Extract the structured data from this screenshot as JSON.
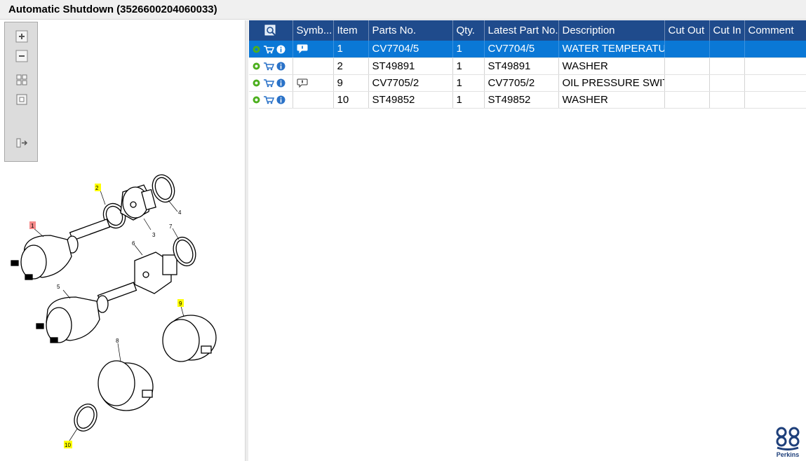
{
  "window": {
    "title": "Automatic Shutdown (3526600204060033)"
  },
  "toolbar": {
    "buttons": [
      {
        "name": "zoom-in-button",
        "icon": "zoom-in-icon"
      },
      {
        "name": "zoom-out-button",
        "icon": "zoom-out-icon"
      },
      {
        "name": "fit-all-button",
        "icon": "fit-all-icon"
      },
      {
        "name": "fit-window-button",
        "icon": "fit-window-icon"
      },
      {
        "name": "toggle-panel-button",
        "icon": "panel-toggle-icon"
      }
    ]
  },
  "diagram": {
    "callouts": [
      {
        "label": "1",
        "highlight": "#f58a8a"
      },
      {
        "label": "2",
        "highlight": "#ffff00"
      },
      {
        "label": "3"
      },
      {
        "label": "4"
      },
      {
        "label": "5"
      },
      {
        "label": "6"
      },
      {
        "label": "7"
      },
      {
        "label": "8"
      },
      {
        "label": "9",
        "highlight": "#ffff00"
      },
      {
        "label": "10",
        "highlight": "#ffff00"
      }
    ]
  },
  "grid": {
    "columns": [
      "",
      "Symb...",
      "Item",
      "Parts No.",
      "Qty.",
      "Latest Part No.",
      "Description",
      "Cut Out",
      "Cut In",
      "Comment"
    ],
    "rows": [
      {
        "symbol": "speech-bubble-icon",
        "item": "1",
        "part_no": "CV7704/5",
        "qty": "1",
        "latest_part_no": "CV7704/5",
        "description": "WATER TEMPERATURE",
        "cut_out": "",
        "cut_in": "",
        "comment": "",
        "selected": true
      },
      {
        "symbol": "",
        "item": "2",
        "part_no": "ST49891",
        "qty": "1",
        "latest_part_no": "ST49891",
        "description": "WASHER",
        "cut_out": "",
        "cut_in": "",
        "comment": "",
        "selected": false
      },
      {
        "symbol": "speech-bubble-icon",
        "item": "9",
        "part_no": "CV7705/2",
        "qty": "1",
        "latest_part_no": "CV7705/2",
        "description": "OIL PRESSURE SWITCH",
        "cut_out": "",
        "cut_in": "",
        "comment": "",
        "selected": false
      },
      {
        "symbol": "",
        "item": "10",
        "part_no": "ST49852",
        "qty": "1",
        "latest_part_no": "ST49852",
        "description": "WASHER",
        "cut_out": "",
        "cut_in": "",
        "comment": "",
        "selected": false
      }
    ]
  },
  "brand": {
    "name": "Perkins",
    "color": "#1e3f7a"
  },
  "colors": {
    "header": "#1f4b8c",
    "selection": "#0a78d6",
    "gear": "#4caf1e",
    "cart": "#2a72c8"
  }
}
